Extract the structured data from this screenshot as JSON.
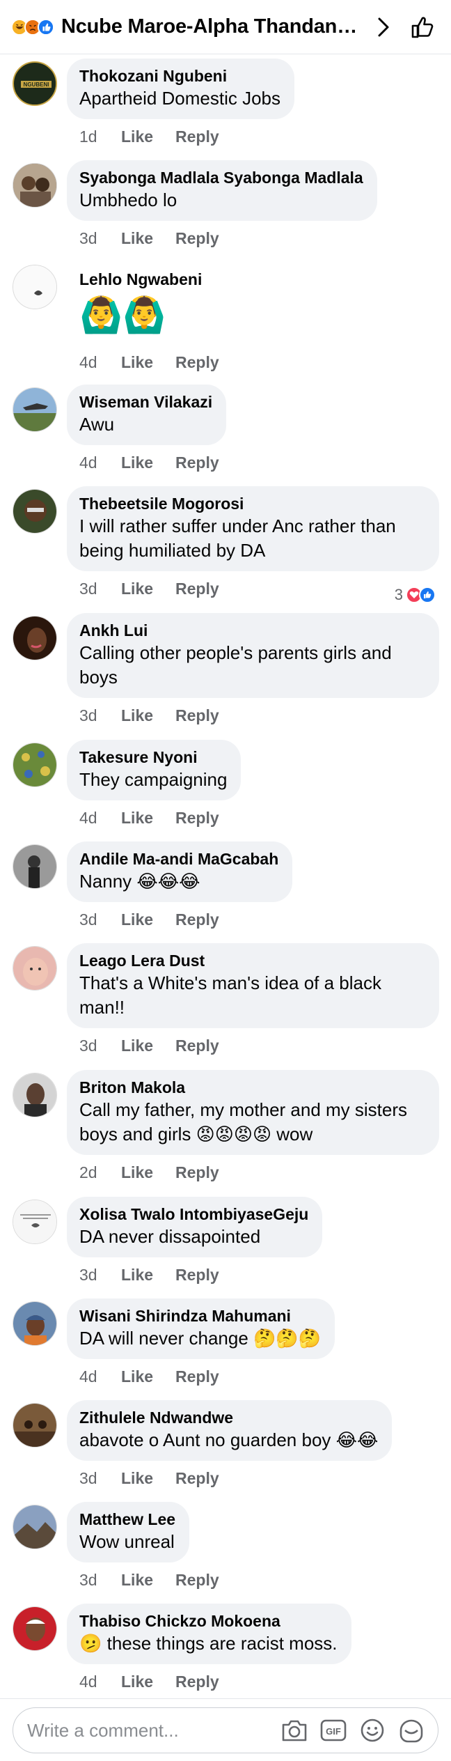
{
  "header": {
    "title": "Ncube Maroe-Alpha Thandanani Dhlamini",
    "reaction_icons": [
      "haha-icon",
      "angry-icon",
      "like-icon"
    ]
  },
  "comments": [
    {
      "name": "Thokozani Ngubeni",
      "text": "Apartheid Domestic Jobs",
      "time": "1d",
      "avatar_color": "#1d2a1a"
    },
    {
      "name": "Syabonga Madlala Syabonga Madlala",
      "text": "Umbhedo lo",
      "time": "3d",
      "avatar_color": "#8a7a6a"
    },
    {
      "name": "Lehlo Ngwabeni",
      "text": "",
      "emojis": [
        "🙆‍♂️",
        "🙆‍♂️"
      ],
      "time": "4d",
      "avatar_color": "#f4f4f4"
    },
    {
      "name": "Wiseman Vilakazi",
      "text": "Awu",
      "time": "4d",
      "avatar_color": "#6f8a4f"
    },
    {
      "name": "Thebeetsile Mogorosi",
      "text": "I will rather suffer under Anc rather than being humiliated by DA",
      "time": "3d",
      "avatar_color": "#5a4030",
      "reaction_count": "3"
    },
    {
      "name": "Ankh Lui",
      "text": "Calling other people's parents girls and boys",
      "time": "3d",
      "avatar_color": "#3a2418"
    },
    {
      "name": "Takesure Nyoni",
      "text": "They campaigning",
      "time": "4d",
      "avatar_color": "#7a9a4a"
    },
    {
      "name": "Andile Ma-andi MaGcabah",
      "text": "Nanny 😂😂😂",
      "time": "3d",
      "avatar_color": "#6e6e6e"
    },
    {
      "name": "Leago Lera Dust",
      "text": "That's a White's man's idea of a black man!!",
      "time": "3d",
      "avatar_color": "#d9a79a"
    },
    {
      "name": "Briton Makola",
      "text": "Call my father, my mother and my sisters boys and girls 😡😡😡😡 wow",
      "time": "2d",
      "avatar_color": "#b9b9b9"
    },
    {
      "name": "Xolisa Twalo IntombiyaseGeju",
      "text": "DA never dissapointed",
      "time": "3d",
      "avatar_color": "#e8e8e8"
    },
    {
      "name": "Wisani Shirindza Mahumani",
      "text": "DA will never change 🤔🤔🤔",
      "time": "4d",
      "avatar_color": "#4a6a8a"
    },
    {
      "name": "Zithulele Ndwandwe",
      "text": "abavote o Aunt no guarden boy 😂😂",
      "time": "3d",
      "avatar_color": "#5a3a22"
    },
    {
      "name": "Matthew Lee",
      "text": "Wow unreal",
      "time": "3d",
      "avatar_color": "#6b7d9a"
    },
    {
      "name": "Thabiso Chickzo Mokoena",
      "text": "🫤 these things are racist moss.",
      "time": "4d",
      "avatar_color": "#c8202a"
    }
  ],
  "labels": {
    "like": "Like",
    "reply": "Reply"
  },
  "footer": {
    "placeholder": "Write a comment...",
    "icons": [
      "camera-icon",
      "gif-icon",
      "emoji-icon",
      "sticker-icon"
    ]
  },
  "colors": {
    "bubble": "#f0f2f5",
    "meta": "#65676b",
    "like_blue": "#1877f2",
    "love_red": "#f33e58"
  }
}
